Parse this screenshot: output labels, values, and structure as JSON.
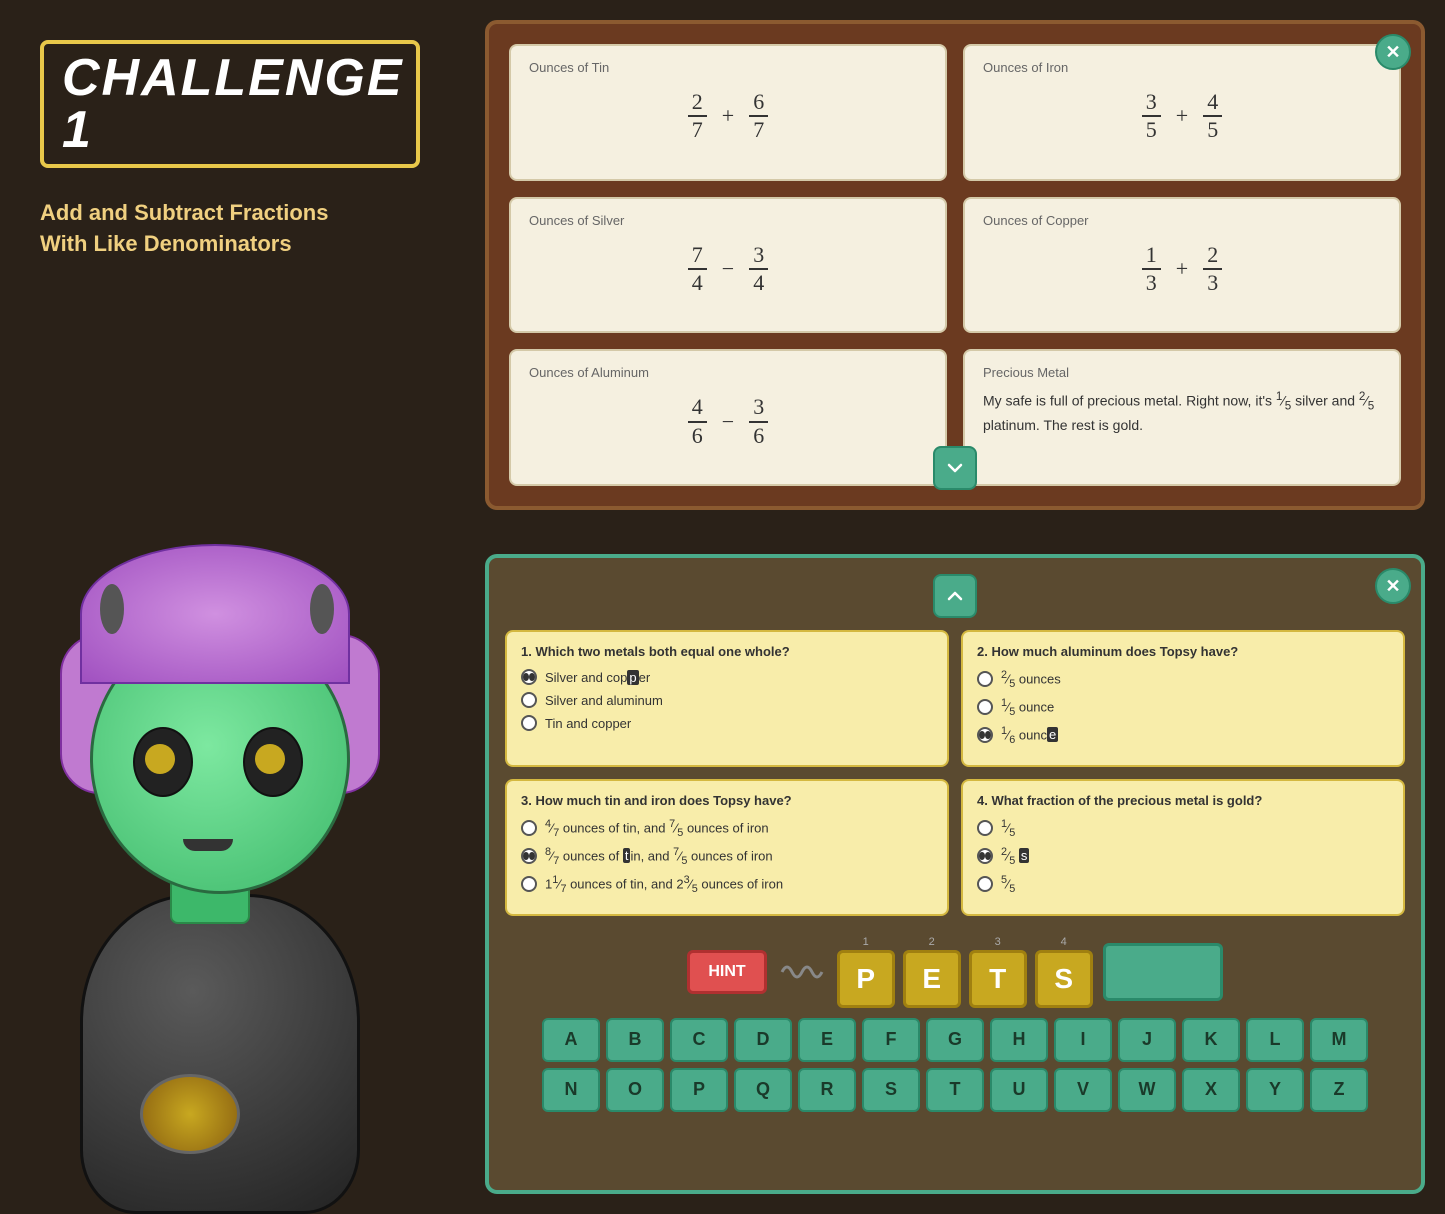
{
  "challenge": {
    "label": "CHALLENGE",
    "number": "1",
    "subtitle_line1": "Add and Subtract Fractions",
    "subtitle_line2": "With Like Denominators"
  },
  "reading_panel": {
    "cards": [
      {
        "id": "tin",
        "title": "Ounces of Tin",
        "numerator1": "2",
        "denominator1": "7",
        "operator": "+",
        "numerator2": "6",
        "denominator2": "7"
      },
      {
        "id": "iron",
        "title": "Ounces of Iron",
        "numerator1": "3",
        "denominator1": "5",
        "operator": "+",
        "numerator2": "4",
        "denominator2": "5"
      },
      {
        "id": "silver",
        "title": "Ounces of Silver",
        "numerator1": "7",
        "denominator1": "4",
        "operator": "−",
        "numerator2": "3",
        "denominator2": "4"
      },
      {
        "id": "copper",
        "title": "Ounces of Copper",
        "numerator1": "1",
        "denominator1": "3",
        "operator": "+",
        "numerator2": "2",
        "denominator2": "3"
      },
      {
        "id": "aluminum",
        "title": "Ounces of Aluminum",
        "numerator1": "4",
        "denominator1": "6",
        "operator": "−",
        "numerator2": "3",
        "denominator2": "6"
      },
      {
        "id": "precious",
        "title": "Precious Metal",
        "text": "My safe is full of precious metal. Right now, it's 1⁄5 silver and 2⁄5 platinum. The rest is gold."
      }
    ]
  },
  "quiz": {
    "questions": [
      {
        "id": 1,
        "text": "1. Which two metals both equal one whole?",
        "options": [
          {
            "id": "a",
            "text": "Silver and copper",
            "selected": true
          },
          {
            "id": "b",
            "text": "Silver and aluminum",
            "selected": false
          },
          {
            "id": "c",
            "text": "Tin and copper",
            "selected": false
          }
        ]
      },
      {
        "id": 2,
        "text": "2. How much aluminum does Topsy have?",
        "options": [
          {
            "id": "a",
            "text": "²⁄₅ ounces",
            "selected": false
          },
          {
            "id": "b",
            "text": "¹⁄₅ ounce",
            "selected": false
          },
          {
            "id": "c",
            "text": "¹⁄₆ ounce",
            "selected": true
          }
        ]
      },
      {
        "id": 3,
        "text": "3. How much tin and iron does Topsy have?",
        "options": [
          {
            "id": "a",
            "text": "⁴⁄₇ ounces of tin, and ⁷⁄₅ ounces of iron",
            "selected": false
          },
          {
            "id": "b",
            "text": "⁸⁄₇ ounces of tin, and ⁷⁄₅ ounces of iron",
            "selected": true
          },
          {
            "id": "c",
            "text": "1¹⁄₇ ounces of tin, and 2³⁄₅ ounces of iron",
            "selected": false
          }
        ]
      },
      {
        "id": 4,
        "text": "4. What fraction of the precious metal is gold?",
        "options": [
          {
            "id": "a",
            "text": "¹⁄₅",
            "selected": false
          },
          {
            "id": "b",
            "text": "²⁄₅",
            "selected": true
          },
          {
            "id": "c",
            "text": "⁵⁄₅",
            "selected": false
          }
        ]
      }
    ],
    "hint_label": "HINT",
    "letter_slots": [
      {
        "number": "1",
        "letter": "P"
      },
      {
        "number": "2",
        "letter": "E"
      },
      {
        "number": "3",
        "letter": "T"
      },
      {
        "number": "4",
        "letter": "S"
      }
    ],
    "keyboard_row1": [
      "A",
      "B",
      "C",
      "D",
      "E",
      "F",
      "G",
      "H",
      "I",
      "J",
      "K",
      "L",
      "M"
    ],
    "keyboard_row2": [
      "N",
      "O",
      "P",
      "Q",
      "R",
      "S",
      "T",
      "U",
      "V",
      "W",
      "X",
      "Y",
      "Z"
    ]
  },
  "colors": {
    "bg": "#2a2118",
    "panel_brown": "#6b3a20",
    "panel_quiz": "#5a4a30",
    "teal": "#4aab8a",
    "yellow_slot": "#c8a820",
    "card_bg": "#f5f0e0",
    "question_bg": "#f8edaa",
    "hint_red": "#e05050",
    "text_dark": "#333333"
  }
}
